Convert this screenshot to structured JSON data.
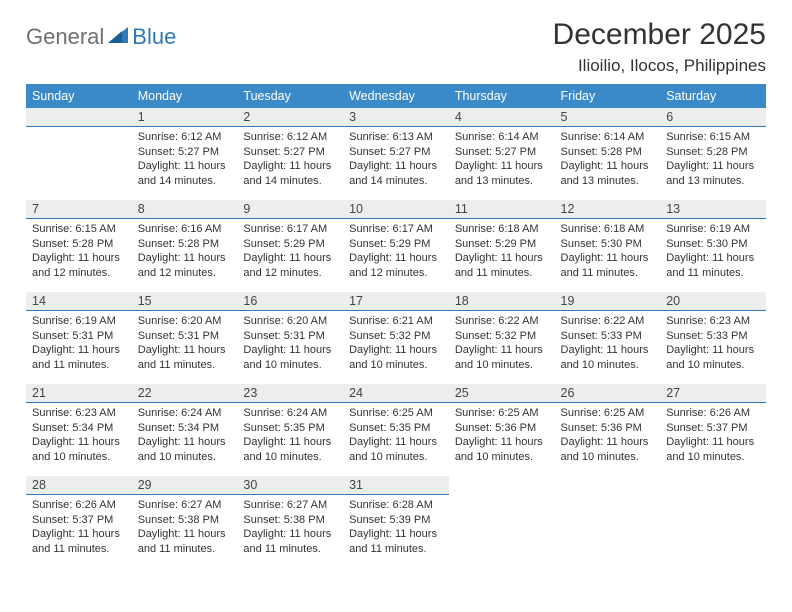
{
  "brand": {
    "general": "General",
    "blue": "Blue"
  },
  "title": "December 2025",
  "location": "Ilioilio, Ilocos, Philippines",
  "weekdays": [
    "Sunday",
    "Monday",
    "Tuesday",
    "Wednesday",
    "Thursday",
    "Friday",
    "Saturday"
  ],
  "weeks": [
    [
      {
        "blank": true
      },
      {
        "day": "1",
        "sunrise": "Sunrise: 6:12 AM",
        "sunset": "Sunset: 5:27 PM",
        "daylight": "Daylight: 11 hours and 14 minutes."
      },
      {
        "day": "2",
        "sunrise": "Sunrise: 6:12 AM",
        "sunset": "Sunset: 5:27 PM",
        "daylight": "Daylight: 11 hours and 14 minutes."
      },
      {
        "day": "3",
        "sunrise": "Sunrise: 6:13 AM",
        "sunset": "Sunset: 5:27 PM",
        "daylight": "Daylight: 11 hours and 14 minutes."
      },
      {
        "day": "4",
        "sunrise": "Sunrise: 6:14 AM",
        "sunset": "Sunset: 5:27 PM",
        "daylight": "Daylight: 11 hours and 13 minutes."
      },
      {
        "day": "5",
        "sunrise": "Sunrise: 6:14 AM",
        "sunset": "Sunset: 5:28 PM",
        "daylight": "Daylight: 11 hours and 13 minutes."
      },
      {
        "day": "6",
        "sunrise": "Sunrise: 6:15 AM",
        "sunset": "Sunset: 5:28 PM",
        "daylight": "Daylight: 11 hours and 13 minutes."
      }
    ],
    [
      {
        "day": "7",
        "sunrise": "Sunrise: 6:15 AM",
        "sunset": "Sunset: 5:28 PM",
        "daylight": "Daylight: 11 hours and 12 minutes."
      },
      {
        "day": "8",
        "sunrise": "Sunrise: 6:16 AM",
        "sunset": "Sunset: 5:28 PM",
        "daylight": "Daylight: 11 hours and 12 minutes."
      },
      {
        "day": "9",
        "sunrise": "Sunrise: 6:17 AM",
        "sunset": "Sunset: 5:29 PM",
        "daylight": "Daylight: 11 hours and 12 minutes."
      },
      {
        "day": "10",
        "sunrise": "Sunrise: 6:17 AM",
        "sunset": "Sunset: 5:29 PM",
        "daylight": "Daylight: 11 hours and 12 minutes."
      },
      {
        "day": "11",
        "sunrise": "Sunrise: 6:18 AM",
        "sunset": "Sunset: 5:29 PM",
        "daylight": "Daylight: 11 hours and 11 minutes."
      },
      {
        "day": "12",
        "sunrise": "Sunrise: 6:18 AM",
        "sunset": "Sunset: 5:30 PM",
        "daylight": "Daylight: 11 hours and 11 minutes."
      },
      {
        "day": "13",
        "sunrise": "Sunrise: 6:19 AM",
        "sunset": "Sunset: 5:30 PM",
        "daylight": "Daylight: 11 hours and 11 minutes."
      }
    ],
    [
      {
        "day": "14",
        "sunrise": "Sunrise: 6:19 AM",
        "sunset": "Sunset: 5:31 PM",
        "daylight": "Daylight: 11 hours and 11 minutes."
      },
      {
        "day": "15",
        "sunrise": "Sunrise: 6:20 AM",
        "sunset": "Sunset: 5:31 PM",
        "daylight": "Daylight: 11 hours and 11 minutes."
      },
      {
        "day": "16",
        "sunrise": "Sunrise: 6:20 AM",
        "sunset": "Sunset: 5:31 PM",
        "daylight": "Daylight: 11 hours and 10 minutes."
      },
      {
        "day": "17",
        "sunrise": "Sunrise: 6:21 AM",
        "sunset": "Sunset: 5:32 PM",
        "daylight": "Daylight: 11 hours and 10 minutes."
      },
      {
        "day": "18",
        "sunrise": "Sunrise: 6:22 AM",
        "sunset": "Sunset: 5:32 PM",
        "daylight": "Daylight: 11 hours and 10 minutes."
      },
      {
        "day": "19",
        "sunrise": "Sunrise: 6:22 AM",
        "sunset": "Sunset: 5:33 PM",
        "daylight": "Daylight: 11 hours and 10 minutes."
      },
      {
        "day": "20",
        "sunrise": "Sunrise: 6:23 AM",
        "sunset": "Sunset: 5:33 PM",
        "daylight": "Daylight: 11 hours and 10 minutes."
      }
    ],
    [
      {
        "day": "21",
        "sunrise": "Sunrise: 6:23 AM",
        "sunset": "Sunset: 5:34 PM",
        "daylight": "Daylight: 11 hours and 10 minutes."
      },
      {
        "day": "22",
        "sunrise": "Sunrise: 6:24 AM",
        "sunset": "Sunset: 5:34 PM",
        "daylight": "Daylight: 11 hours and 10 minutes."
      },
      {
        "day": "23",
        "sunrise": "Sunrise: 6:24 AM",
        "sunset": "Sunset: 5:35 PM",
        "daylight": "Daylight: 11 hours and 10 minutes."
      },
      {
        "day": "24",
        "sunrise": "Sunrise: 6:25 AM",
        "sunset": "Sunset: 5:35 PM",
        "daylight": "Daylight: 11 hours and 10 minutes."
      },
      {
        "day": "25",
        "sunrise": "Sunrise: 6:25 AM",
        "sunset": "Sunset: 5:36 PM",
        "daylight": "Daylight: 11 hours and 10 minutes."
      },
      {
        "day": "26",
        "sunrise": "Sunrise: 6:25 AM",
        "sunset": "Sunset: 5:36 PM",
        "daylight": "Daylight: 11 hours and 10 minutes."
      },
      {
        "day": "27",
        "sunrise": "Sunrise: 6:26 AM",
        "sunset": "Sunset: 5:37 PM",
        "daylight": "Daylight: 11 hours and 10 minutes."
      }
    ],
    [
      {
        "day": "28",
        "sunrise": "Sunrise: 6:26 AM",
        "sunset": "Sunset: 5:37 PM",
        "daylight": "Daylight: 11 hours and 11 minutes."
      },
      {
        "day": "29",
        "sunrise": "Sunrise: 6:27 AM",
        "sunset": "Sunset: 5:38 PM",
        "daylight": "Daylight: 11 hours and 11 minutes."
      },
      {
        "day": "30",
        "sunrise": "Sunrise: 6:27 AM",
        "sunset": "Sunset: 5:38 PM",
        "daylight": "Daylight: 11 hours and 11 minutes."
      },
      {
        "day": "31",
        "sunrise": "Sunrise: 6:28 AM",
        "sunset": "Sunset: 5:39 PM",
        "daylight": "Daylight: 11 hours and 11 minutes."
      },
      {
        "blank": true
      },
      {
        "blank": true
      },
      {
        "blank": true
      }
    ]
  ]
}
